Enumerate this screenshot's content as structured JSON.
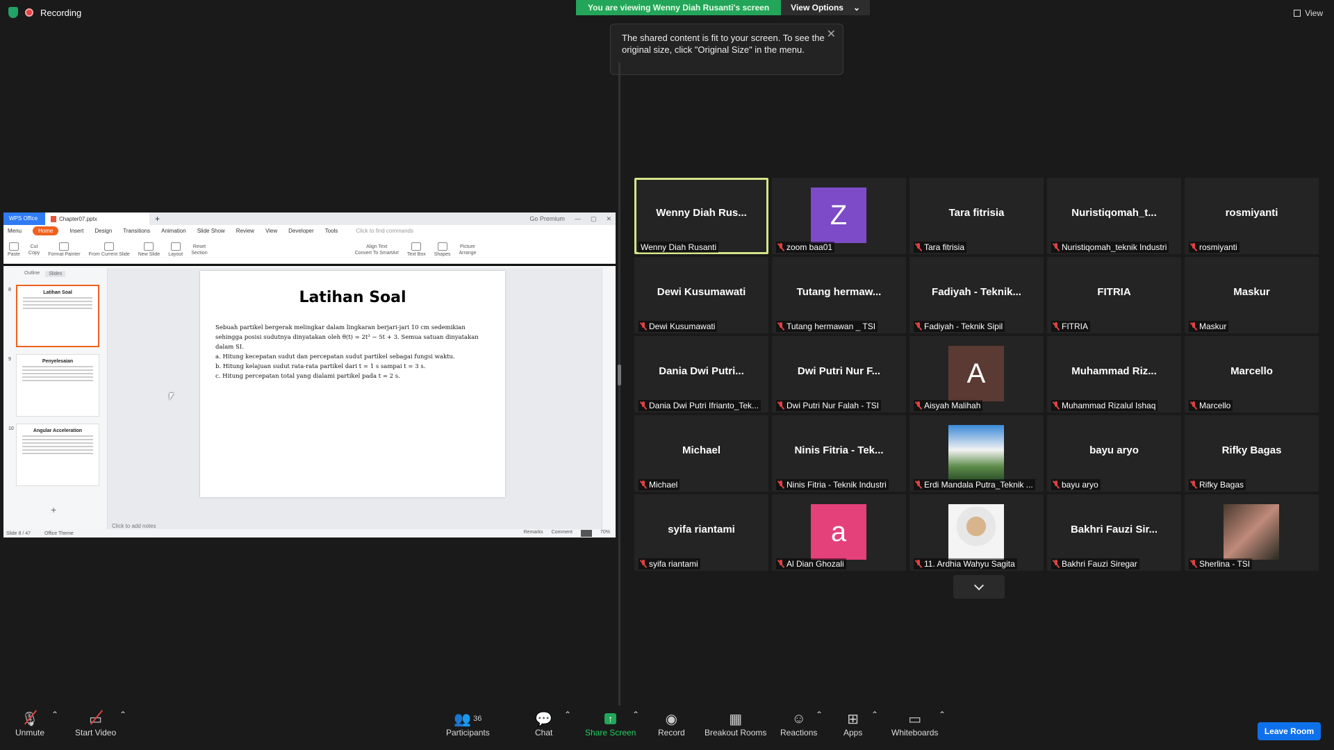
{
  "top": {
    "recording": "Recording",
    "banner": "You are viewing Wenny Diah Rusanti's screen",
    "view_options": "View Options",
    "view": "View"
  },
  "tooltip": {
    "text": "The shared content is fit to your screen. To see the original size, click \"Original Size\" in the menu."
  },
  "wps": {
    "app_tab": "WPS Office",
    "doc_tab": "Chapter07.pptx",
    "premium": "Go Premium",
    "menu": [
      "Menu",
      "Home",
      "Insert",
      "Design",
      "Transitions",
      "Animation",
      "Slide Show",
      "Review",
      "View",
      "Developer",
      "Tools"
    ],
    "find": "Click to find commands",
    "ribbon": [
      "Paste",
      "Cut",
      "Copy",
      "Format Painter",
      "From Current Slide",
      "New Slide",
      "Layout",
      "Reset",
      "Section",
      "Align Text",
      "Convert To SmartArt",
      "Text Box",
      "Shapes",
      "Picture",
      "Arrange"
    ],
    "pane_tabs": [
      "Outline",
      "Slides"
    ],
    "thumbs": [
      {
        "num": "8",
        "title": "Latihan Soal"
      },
      {
        "num": "9",
        "title": "Penyelesaian"
      },
      {
        "num": "10",
        "title": "Angular Acceleration"
      }
    ],
    "slide": {
      "title": "Latihan Soal",
      "lines": [
        "Sebuah partikel bergerak melingkar dalam lingkaran berjari-jari 10 cm sedemikian sehingga posisi sudutnya dinyatakan oleh θ(t) = 2t³ − 5t + 3. Semua satuan dinyatakan dalam SI.",
        "a. Hitung kecepatan sudut dan percepatan sudut partikel sebagai fungsi waktu.",
        "b. Hitung kelajuan sudut rata-rata partikel dari t = 1 s sampai t = 3 s.",
        "c. Hitung percepatan total yang dialami partikel pada t = 2 s."
      ]
    },
    "notes": "Click to add notes",
    "status_slide": "Slide 8 / 47",
    "status_theme": "Office Theme",
    "status_remarks": "Remarks",
    "status_comment": "Comment",
    "zoom": "70%"
  },
  "participants": [
    {
      "name": "Wenny Diah Rus...",
      "label": "Wenny Diah Rusanti",
      "muted": false,
      "active": true
    },
    {
      "avatar": "Z",
      "color": "#7d4bc7",
      "label": "zoom baa01",
      "muted": true
    },
    {
      "name": "Tara fitrisia",
      "label": "Tara fitrisia",
      "muted": true
    },
    {
      "name": "Nuristiqomah_t...",
      "label": "Nuristiqomah_teknik Industri",
      "muted": true
    },
    {
      "name": "rosmiyanti",
      "label": "rosmiyanti",
      "muted": true
    },
    {
      "name": "Dewi Kusumawati",
      "label": "Dewi Kusumawati",
      "muted": true
    },
    {
      "name": "Tutang hermaw...",
      "label": "Tutang hermawan _ TSI",
      "muted": true
    },
    {
      "name": "Fadiyah - Teknik...",
      "label": "Fadiyah - Teknik Sipil",
      "muted": true
    },
    {
      "name": "FITRIA",
      "label": "FITRIA",
      "muted": true
    },
    {
      "name": "Maskur",
      "label": "Maskur",
      "muted": true
    },
    {
      "name": "Dania Dwi Putri...",
      "label": "Dania Dwi Putri Ifrianto_Tek...",
      "muted": true
    },
    {
      "name": "Dwi Putri Nur F...",
      "label": "Dwi Putri Nur Falah - TSI",
      "muted": true
    },
    {
      "avatar": "A",
      "color": "#5a3a32",
      "label": "Aisyah Malihah",
      "muted": true
    },
    {
      "name": "Muhammad Riz...",
      "label": "Muhammad Rizalul Ishaq",
      "muted": true
    },
    {
      "name": "Marcello",
      "label": "Marcello",
      "muted": true
    },
    {
      "name": "Michael",
      "label": "Michael",
      "muted": true
    },
    {
      "name": "Ninis Fitria - Tek...",
      "label": "Ninis Fitria - Teknik Industri",
      "muted": true
    },
    {
      "photo": "sky",
      "label": "Erdi Mandala Putra_Teknik ...",
      "muted": true
    },
    {
      "name": "bayu aryo",
      "label": "bayu aryo",
      "muted": true
    },
    {
      "name": "Rifky Bagas",
      "label": "Rifky Bagas",
      "muted": true
    },
    {
      "name": "syifa riantami",
      "label": "syifa riantami",
      "muted": true
    },
    {
      "avatar": "a",
      "color": "#e4407a",
      "label": "Al Dian Ghozali",
      "muted": true
    },
    {
      "photo": "portrait",
      "label": "11. Ardhia Wahyu Sagita",
      "muted": true
    },
    {
      "name": "Bakhri Fauzi Sir...",
      "label": "Bakhri Fauzi Siregar",
      "muted": true
    },
    {
      "photo": "selfie",
      "label": "Sherlina - TSI",
      "muted": true
    }
  ],
  "toolbar": {
    "unmute": "Unmute",
    "start_video": "Start Video",
    "participants": "Participants",
    "participant_count": "36",
    "chat": "Chat",
    "share_screen": "Share Screen",
    "record": "Record",
    "breakout": "Breakout Rooms",
    "reactions": "Reactions",
    "apps": "Apps",
    "whiteboards": "Whiteboards",
    "leave": "Leave Room"
  }
}
